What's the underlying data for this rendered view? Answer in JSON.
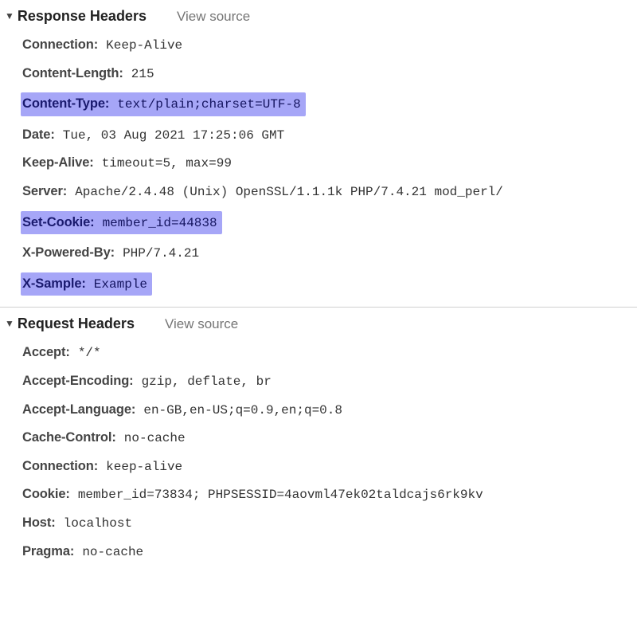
{
  "sections": {
    "response": {
      "title": "Response Headers",
      "viewSource": "View source",
      "headers": {
        "connection": {
          "name": "Connection:",
          "value": "Keep-Alive",
          "highlighted": false
        },
        "contentLength": {
          "name": "Content-Length:",
          "value": "215",
          "highlighted": false
        },
        "contentType": {
          "name": "Content-Type:",
          "value": "text/plain;charset=UTF-8",
          "highlighted": true
        },
        "date": {
          "name": "Date:",
          "value": "Tue, 03 Aug 2021 17:25:06 GMT",
          "highlighted": false
        },
        "keepAlive": {
          "name": "Keep-Alive:",
          "value": "timeout=5, max=99",
          "highlighted": false
        },
        "server": {
          "name": "Server:",
          "value": "Apache/2.4.48 (Unix) OpenSSL/1.1.1k PHP/7.4.21 mod_perl/",
          "highlighted": false
        },
        "setCookie": {
          "name": "Set-Cookie:",
          "value": "member_id=44838",
          "highlighted": true
        },
        "xPoweredBy": {
          "name": "X-Powered-By:",
          "value": "PHP/7.4.21",
          "highlighted": false
        },
        "xSample": {
          "name": "X-Sample:",
          "value": "Example",
          "highlighted": true
        }
      }
    },
    "request": {
      "title": "Request Headers",
      "viewSource": "View source",
      "headers": {
        "accept": {
          "name": "Accept:",
          "value": "*/*",
          "highlighted": false
        },
        "acceptEncoding": {
          "name": "Accept-Encoding:",
          "value": "gzip, deflate, br",
          "highlighted": false
        },
        "acceptLanguage": {
          "name": "Accept-Language:",
          "value": "en-GB,en-US;q=0.9,en;q=0.8",
          "highlighted": false
        },
        "cacheControl": {
          "name": "Cache-Control:",
          "value": "no-cache",
          "highlighted": false
        },
        "connection": {
          "name": "Connection:",
          "value": "keep-alive",
          "highlighted": false
        },
        "cookie": {
          "name": "Cookie:",
          "value": "member_id=73834; PHPSESSID=4aovml47ek02taldcajs6rk9kv",
          "highlighted": false
        },
        "host": {
          "name": "Host:",
          "value": "localhost",
          "highlighted": false
        },
        "pragma": {
          "name": "Pragma:",
          "value": "no-cache",
          "highlighted": false
        }
      }
    }
  }
}
